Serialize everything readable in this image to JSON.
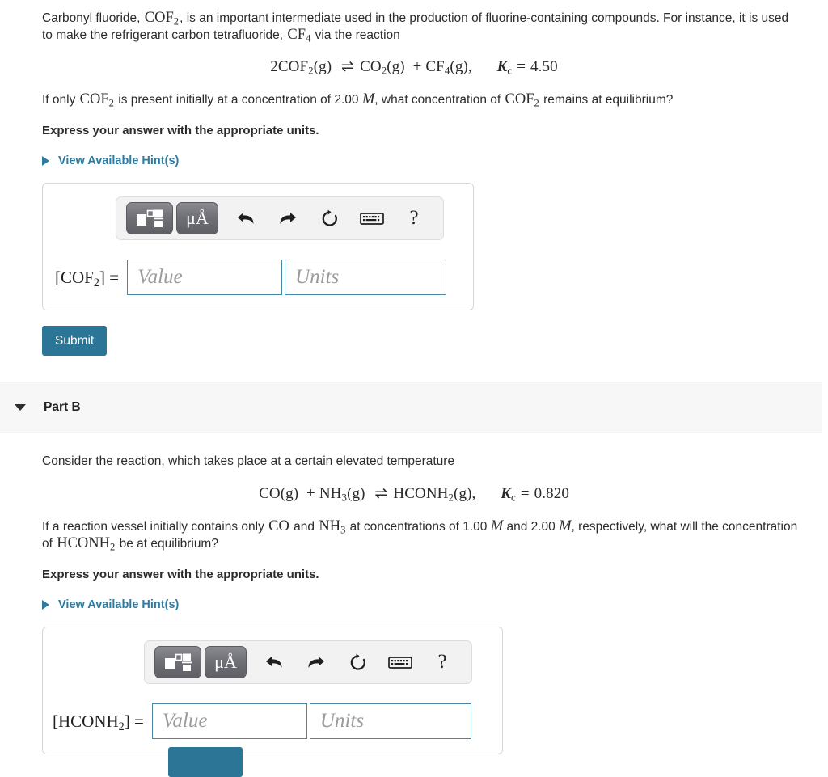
{
  "part_a": {
    "intro_1": "Carbonyl fluoride, ",
    "formula_cof2": "COF",
    "formula_cof2_sub": "2",
    "intro_2": ", is an important intermediate used in the production of fluorine-containing compounds. For instance, it is used to make the refrigerant carbon tetrafluoride, ",
    "formula_cf4": "CF",
    "formula_cf4_sub": "4",
    "intro_3": " via the reaction",
    "equation": {
      "coefficient": "2",
      "reactant": "COF",
      "reactant_sub": "2",
      "reactant_state": "(g)",
      "arrow": "⇌",
      "product1": "CO",
      "product1_sub": "2",
      "product1_state": "(g)",
      "plus": "+",
      "product2": "CF",
      "product2_sub": "4",
      "product2_state": "(g),",
      "kc_symbol": "K",
      "kc_sub": "c",
      "kc_equals": "=",
      "kc_value": "4.50"
    },
    "question_1": "If only ",
    "question_species": "COF",
    "question_species_sub": "2",
    "question_2": " is present initially at a concentration of 2.00 ",
    "question_unit": "M",
    "question_3": ", what concentration of ",
    "question_species2": "COF",
    "question_species2_sub": "2",
    "question_4": " remains at equilibrium?",
    "instruction": "Express your answer with the appropriate units.",
    "hints_label": "View Available Hint(s)",
    "answer_label_open": "[",
    "answer_label_species": "COF",
    "answer_label_sub": "2",
    "answer_label_close": "] =",
    "value_placeholder": "Value",
    "units_placeholder": "Units",
    "value_current": "",
    "units_current": "",
    "submit_label": "Submit"
  },
  "part_b": {
    "header_title": "Part B",
    "intro": "Consider the reaction, which takes place at a certain elevated temperature",
    "equation": {
      "reactant1": "CO",
      "reactant1_state": "(g)",
      "plus": "+",
      "reactant2": "NH",
      "reactant2_sub": "3",
      "reactant2_state": "(g)",
      "arrow": "⇌",
      "product": "HCONH",
      "product_sub": "2",
      "product_state": "(g),",
      "kc_symbol": "K",
      "kc_sub": "c",
      "kc_equals": "=",
      "kc_value": "0.820"
    },
    "question_1": "If a reaction vessel initially contains only ",
    "question_species1": "CO",
    "question_2": " and ",
    "question_species2": "NH",
    "question_species2_sub": "3",
    "question_3": " at concentrations of 1.00 ",
    "question_unit1": "M",
    "question_4": " and 2.00 ",
    "question_unit2": "M",
    "question_5": ", respectively, what will the concentration of ",
    "question_species3": "HCONH",
    "question_species3_sub": "2",
    "question_6": " be at equilibrium?",
    "instruction": "Express your answer with the appropriate units.",
    "hints_label": "View Available Hint(s)",
    "answer_label_open": "[",
    "answer_label_species": "HCONH",
    "answer_label_sub": "2",
    "answer_label_close": "] =",
    "value_placeholder": "Value",
    "units_placeholder": "Units",
    "value_current": "",
    "units_current": ""
  },
  "toolbar": {
    "template_icon": "math-template-icon",
    "units_label": "μÅ",
    "undo_icon": "undo-arrow-icon",
    "redo_icon": "redo-arrow-icon",
    "reset_icon": "reset-circular-arrow-icon",
    "keyboard_icon": "keyboard-icon",
    "help_label": "?"
  },
  "colors": {
    "accent_teal": "#2d7596",
    "link_blue": "#2e7ba0",
    "input_border": "#4a86a5",
    "header_band": "#f7f7f7"
  }
}
